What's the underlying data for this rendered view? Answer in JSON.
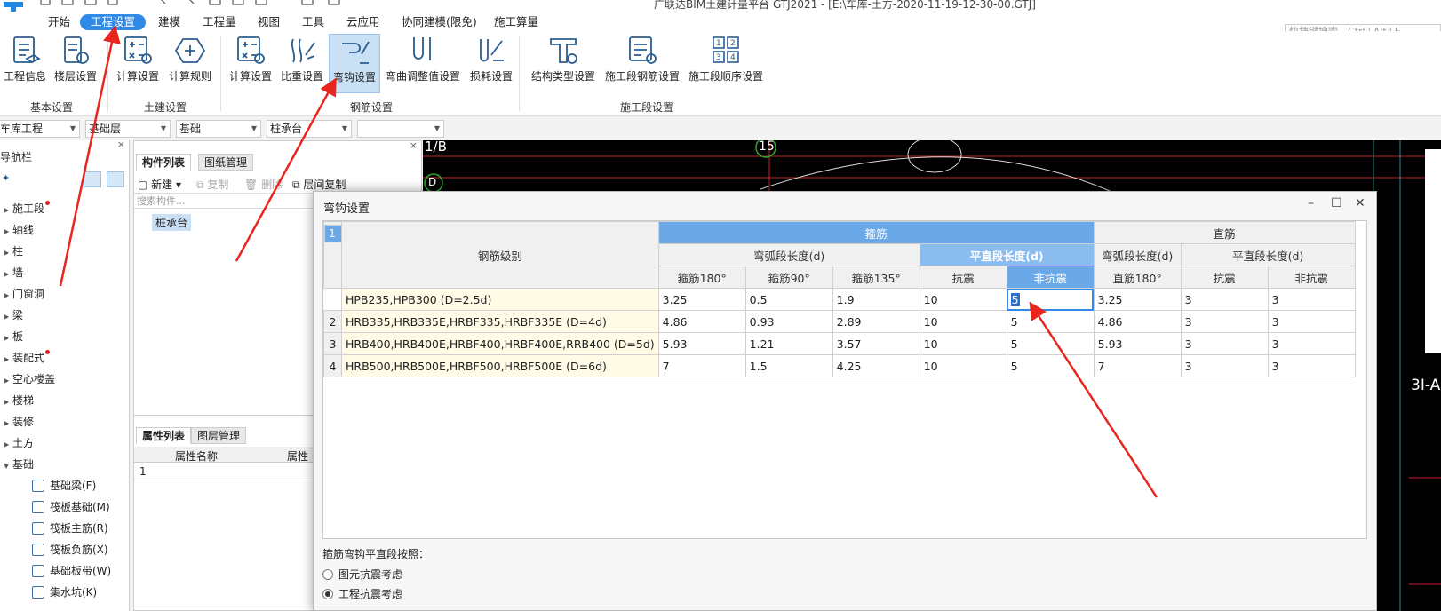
{
  "window": {
    "title": "广联达BIM土建计量平台 GTJ2021 - [E:\\车库-土方-2020-11-19-12-30-00.GTJ]"
  },
  "menu": {
    "items": [
      "开始",
      "工程设置",
      "建模",
      "工程量",
      "视图",
      "工具",
      "云应用",
      "协同建模(限免)",
      "施工算量"
    ],
    "active": "工程设置",
    "quick_search_placeholder": "快捷键搜索，Ctrl+Alt+E"
  },
  "ribbon": {
    "buttons": [
      {
        "label": "工程信息",
        "icon": "project-info-icon"
      },
      {
        "label": "楼层设置",
        "icon": "floor-settings-icon"
      },
      {
        "label": "计算设置",
        "icon": "calc-settings-icon"
      },
      {
        "label": "计算规则",
        "icon": "calc-rules-icon"
      },
      {
        "label": "计算设置",
        "icon": "rebar-calc-settings-icon"
      },
      {
        "label": "比重设置",
        "icon": "density-settings-icon"
      },
      {
        "label": "弯钩设置",
        "icon": "hook-settings-icon"
      },
      {
        "label": "弯曲调整值设置",
        "icon": "bend-adjust-icon"
      },
      {
        "label": "损耗设置",
        "icon": "loss-settings-icon"
      },
      {
        "label": "结构类型设置",
        "icon": "structure-type-icon"
      },
      {
        "label": "施工段钢筋设置",
        "icon": "segment-rebar-icon"
      },
      {
        "label": "施工段顺序设置",
        "icon": "segment-order-icon"
      }
    ],
    "groups": [
      "基本设置",
      "土建设置",
      "钢筋设置",
      "施工段设置"
    ]
  },
  "selectors": [
    "车库工程",
    "基础层",
    "基础",
    "桩承台",
    ""
  ],
  "nav": {
    "header": "导航栏",
    "items": [
      {
        "label": "施工段",
        "dot": true
      },
      {
        "label": "轴线",
        "dot": false
      },
      {
        "label": "柱",
        "dot": false
      },
      {
        "label": "墙",
        "dot": false
      },
      {
        "label": "门窗洞",
        "dot": false
      },
      {
        "label": "梁",
        "dot": false
      },
      {
        "label": "板",
        "dot": false
      },
      {
        "label": "装配式",
        "dot": true
      },
      {
        "label": "空心楼盖",
        "dot": false
      },
      {
        "label": "楼梯",
        "dot": false
      },
      {
        "label": "装修",
        "dot": false
      },
      {
        "label": "土方",
        "dot": false
      },
      {
        "label": "基础",
        "dot": false
      }
    ],
    "sub_items": [
      "基础梁(F)",
      "筏板基础(M)",
      "筏板主筋(R)",
      "筏板负筋(X)",
      "基础板带(W)",
      "集水坑(K)"
    ]
  },
  "components": {
    "tabs": [
      "构件列表",
      "图纸管理"
    ],
    "toolbar": {
      "new": "新建",
      "copy": "复制",
      "delete": "删除",
      "floor_copy": "层间复制"
    },
    "search_placeholder": "搜索构件...",
    "selected_item": "桩承台",
    "prop_tabs": [
      "属性列表",
      "图层管理"
    ],
    "prop_headers": [
      "属性名称",
      "属性"
    ],
    "prop_row": "1"
  },
  "canvas": {
    "labels": [
      "1/B",
      "15",
      "D",
      "3I-A"
    ]
  },
  "dialog": {
    "title": "弯钩设置",
    "headers": {
      "grade": "钢筋级别",
      "stirrup": "箍筋",
      "straight": "直筋",
      "arc_length": "弯弧段长度(d)",
      "flat_length": "平直段长度(d)",
      "arc_length_straight": "弯弧段长度(d)",
      "flat_length_straight": "平直段长度(d)",
      "sub": [
        "箍筋180°",
        "箍筋90°",
        "箍筋135°",
        "抗震",
        "非抗震",
        "直筋180°",
        "抗震",
        "非抗震"
      ]
    },
    "rows": [
      {
        "no": "1",
        "grade": "HPB235,HPB300 (D=2.5d)",
        "v": [
          "3.25",
          "0.5",
          "1.9",
          "10",
          "5",
          "3.25",
          "3",
          "3"
        ]
      },
      {
        "no": "2",
        "grade": "HRB335,HRB335E,HRBF335,HRBF335E (D=4d)",
        "v": [
          "4.86",
          "0.93",
          "2.89",
          "10",
          "5",
          "4.86",
          "3",
          "3"
        ]
      },
      {
        "no": "3",
        "grade": "HRB400,HRB400E,HRBF400,HRBF400E,RRB400 (D=5d)",
        "v": [
          "5.93",
          "1.21",
          "3.57",
          "10",
          "5",
          "5.93",
          "3",
          "3"
        ]
      },
      {
        "no": "4",
        "grade": "HRB500,HRB500E,HRBF500,HRBF500E (D=6d)",
        "v": [
          "7",
          "1.5",
          "4.25",
          "10",
          "5",
          "7",
          "3",
          "3"
        ]
      }
    ],
    "option_label": "箍筋弯钩平直段按照：",
    "options": [
      {
        "label": "图元抗震考虑",
        "checked": false
      },
      {
        "label": "工程抗震考虑",
        "checked": true
      }
    ]
  },
  "colors": {
    "accent": "#2f8ae8",
    "annotation": "#e8261e"
  }
}
